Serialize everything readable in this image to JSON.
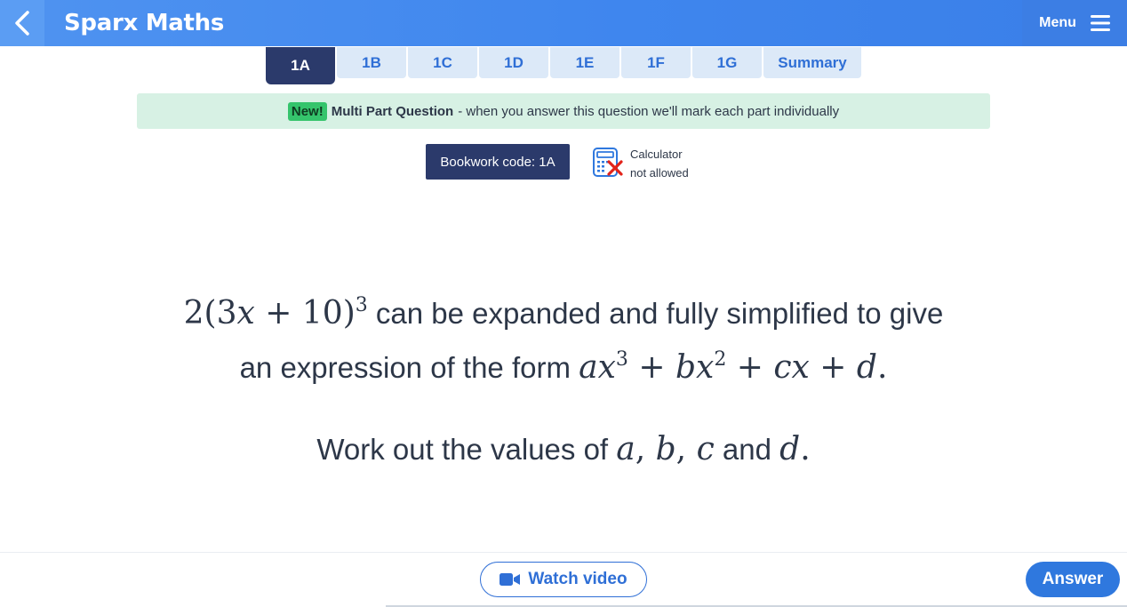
{
  "header": {
    "brand": "Sparx Maths",
    "menu_label": "Menu",
    "back_icon": "chevron-left-icon",
    "menu_icon": "hamburger-icon"
  },
  "tabs": [
    {
      "label": "1A",
      "active": true
    },
    {
      "label": "1B",
      "active": false
    },
    {
      "label": "1C",
      "active": false
    },
    {
      "label": "1D",
      "active": false
    },
    {
      "label": "1E",
      "active": false
    },
    {
      "label": "1F",
      "active": false
    },
    {
      "label": "1G",
      "active": false
    },
    {
      "label": "Summary",
      "active": false
    }
  ],
  "banner": {
    "badge": "New!",
    "title": "Multi Part Question",
    "text": "- when you answer this question we'll mark each part individually"
  },
  "bookwork": {
    "label": "Bookwork code: 1A"
  },
  "calculator": {
    "line1": "Calculator",
    "line2": "not allowed",
    "icon": "calculator-not-allowed-icon"
  },
  "question": {
    "line1_text": "can be expanded and fully simplified to give",
    "line2_text": "an expression of the form",
    "line3_text": "Work out the values of",
    "and_text": "and"
  },
  "footer": {
    "watch_label": "Watch video",
    "answer_label": "Answer",
    "video_icon": "video-camera-icon"
  },
  "colors": {
    "header_blue": "#3f86ee",
    "navy": "#2b3a6b",
    "link_blue": "#2f6fd6",
    "banner_green": "#d7f1e4",
    "badge_green": "#35c46c"
  }
}
